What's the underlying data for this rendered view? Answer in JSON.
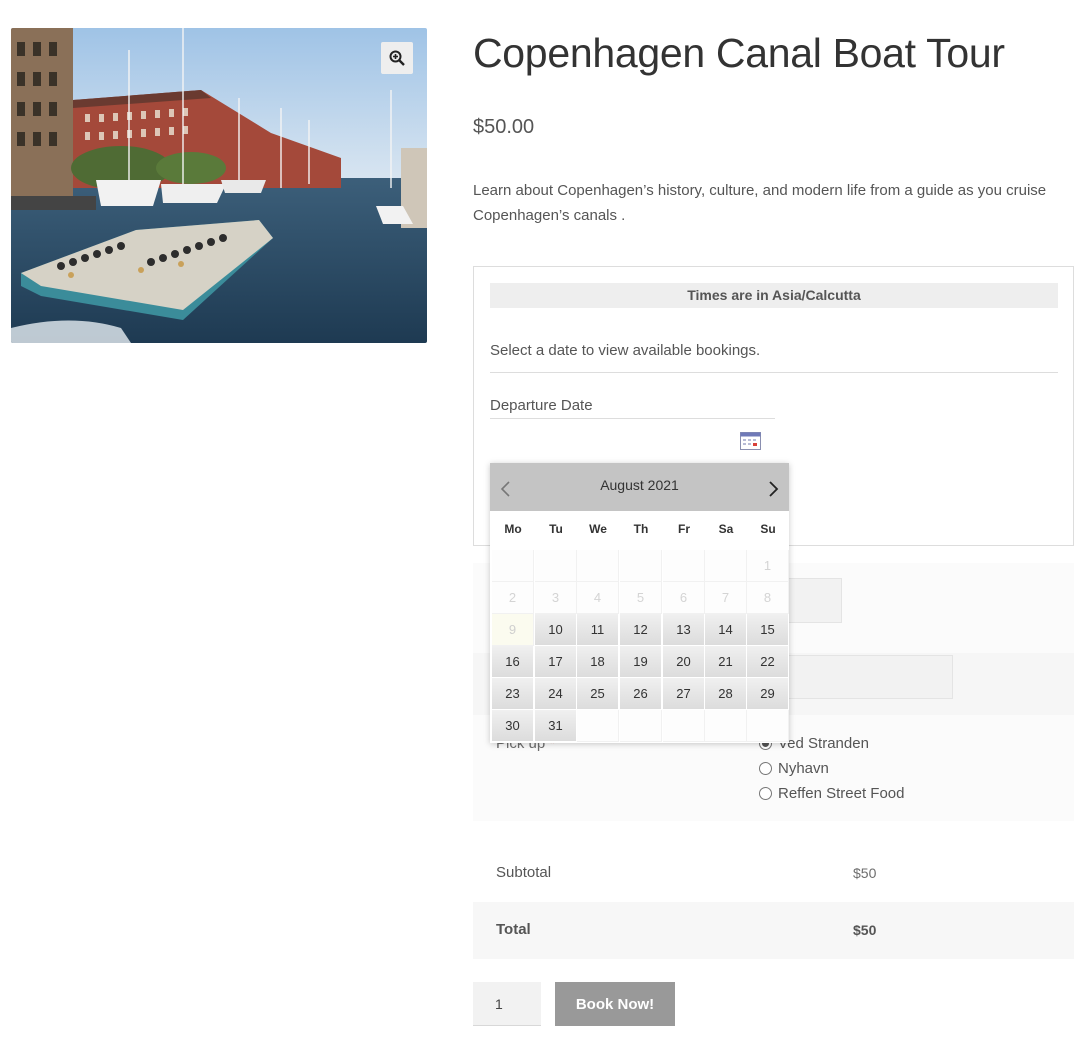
{
  "product": {
    "title": "Copenhagen Canal Boat Tour",
    "price": "$50.00",
    "description": "Learn about Copenhagen’s history, culture, and modern life from a guide as you cruise Copenhagen’s canals ."
  },
  "icons": {
    "zoom": "zoom-in-icon",
    "calendar": "calendar-icon",
    "prev": "chevron-left-icon",
    "next": "chevron-right-icon"
  },
  "booking": {
    "timezone_notice": "Times are in Asia/Calcutta",
    "select_message": "Select a date to view available bookings.",
    "departure_label": "Departure Date"
  },
  "calendar": {
    "month_label": "August 2021",
    "weekdays": [
      "Mo",
      "Tu",
      "We",
      "Th",
      "Fr",
      "Sa",
      "Su"
    ],
    "weeks": [
      [
        {
          "d": "",
          "s": "empty"
        },
        {
          "d": "",
          "s": "empty"
        },
        {
          "d": "",
          "s": "empty"
        },
        {
          "d": "",
          "s": "empty"
        },
        {
          "d": "",
          "s": "empty"
        },
        {
          "d": "",
          "s": "empty"
        },
        {
          "d": "1",
          "s": "disabled"
        }
      ],
      [
        {
          "d": "2",
          "s": "disabled"
        },
        {
          "d": "3",
          "s": "disabled"
        },
        {
          "d": "4",
          "s": "disabled"
        },
        {
          "d": "5",
          "s": "disabled"
        },
        {
          "d": "6",
          "s": "disabled"
        },
        {
          "d": "7",
          "s": "disabled"
        },
        {
          "d": "8",
          "s": "disabled"
        }
      ],
      [
        {
          "d": "9",
          "s": "today"
        },
        {
          "d": "10",
          "s": "avail"
        },
        {
          "d": "11",
          "s": "avail"
        },
        {
          "d": "12",
          "s": "avail"
        },
        {
          "d": "13",
          "s": "avail"
        },
        {
          "d": "14",
          "s": "avail"
        },
        {
          "d": "15",
          "s": "avail"
        }
      ],
      [
        {
          "d": "16",
          "s": "avail"
        },
        {
          "d": "17",
          "s": "avail"
        },
        {
          "d": "18",
          "s": "avail"
        },
        {
          "d": "19",
          "s": "avail"
        },
        {
          "d": "20",
          "s": "avail"
        },
        {
          "d": "21",
          "s": "avail"
        },
        {
          "d": "22",
          "s": "avail"
        }
      ],
      [
        {
          "d": "23",
          "s": "avail"
        },
        {
          "d": "24",
          "s": "avail"
        },
        {
          "d": "25",
          "s": "avail"
        },
        {
          "d": "26",
          "s": "avail"
        },
        {
          "d": "27",
          "s": "avail"
        },
        {
          "d": "28",
          "s": "avail"
        },
        {
          "d": "29",
          "s": "avail"
        }
      ],
      [
        {
          "d": "30",
          "s": "avail"
        },
        {
          "d": "31",
          "s": "avail"
        },
        {
          "d": "",
          "s": "empty"
        },
        {
          "d": "",
          "s": "empty"
        },
        {
          "d": "",
          "s": "empty"
        },
        {
          "d": "",
          "s": "empty"
        },
        {
          "d": "",
          "s": "empty"
        }
      ]
    ]
  },
  "pickup": {
    "label": "Pick up",
    "required_mark": "*",
    "options": [
      {
        "label": "Ved Stranden",
        "checked": true
      },
      {
        "label": "Nyhavn",
        "checked": false
      },
      {
        "label": "Reffen Street Food",
        "checked": false
      }
    ]
  },
  "totals": {
    "subtotal_label": "Subtotal",
    "subtotal_value": "$50",
    "total_label": "Total",
    "total_value": "$50"
  },
  "cart": {
    "quantity": "1",
    "book_label": "Book Now!"
  }
}
